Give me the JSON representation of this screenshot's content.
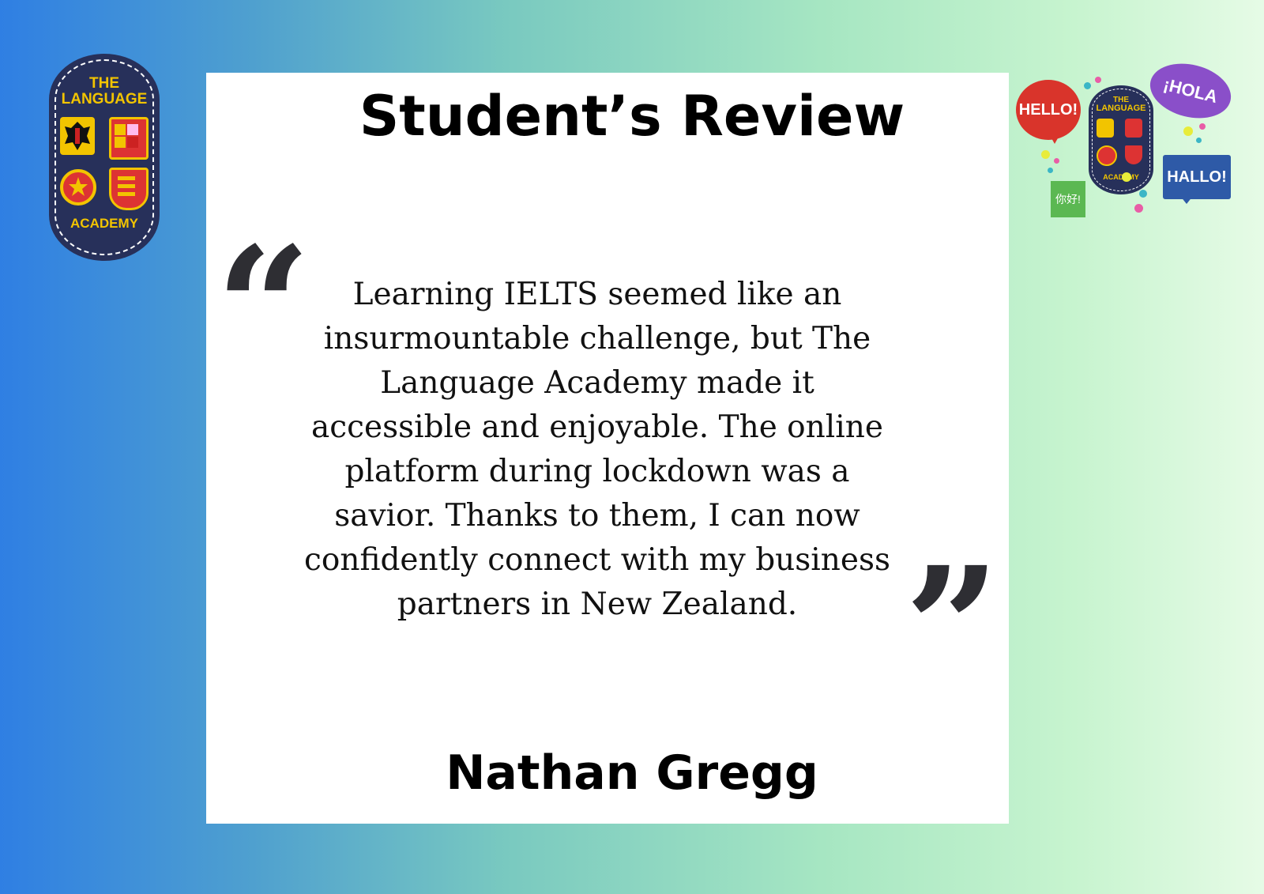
{
  "title": "Student’s Review",
  "review_text": "Learning IELTS seemed like an\ninsurmountable challenge, but The\nLanguage Academy made it\naccessible and enjoyable. The online\nplatform during lockdown was a\nsavior. Thanks to them, I can now\nconfidently connect with my business\npartners in New Zealand.",
  "author": "Nathan Gregg",
  "quote_open": "“",
  "quote_close": "”",
  "logo": {
    "line1": "THE",
    "line2": "LANGUAGE",
    "line3": "ACADEMY"
  },
  "speech_bubbles": {
    "hello": "HELLO!",
    "hola": "¡HOLA",
    "hallo": "HALLO!",
    "nihao": "你好!"
  },
  "colors": {
    "badge": "#27305a",
    "badge_text": "#f2c400",
    "gradient_left": "#2f7fe3",
    "gradient_right": "#e6fbe6"
  }
}
